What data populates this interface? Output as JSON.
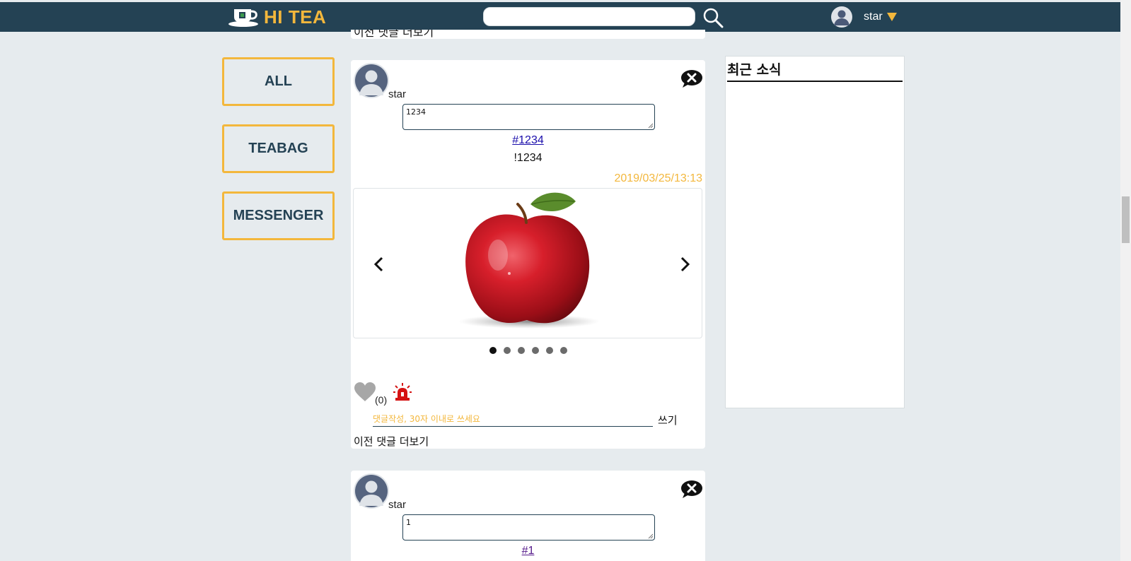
{
  "header": {
    "brand": "HI TEA",
    "search": {
      "placeholder": ""
    },
    "user": {
      "name": "star"
    }
  },
  "colors": {
    "header_bg": "#244254",
    "accent": "#f3b73c",
    "page_bg": "#e6ebee"
  },
  "icons": {
    "logo": "teacup-logo-icon",
    "search": "magnifier-icon",
    "user_avatar": "user-avatar-icon",
    "menu_caret": "caret-down-icon",
    "delete": "close-bubble-icon",
    "like": "heart-icon",
    "report": "siren-icon",
    "prev": "chevron-left-icon",
    "next": "chevron-right-icon"
  },
  "categories": [
    {
      "label": "ALL"
    },
    {
      "label": "TEABAG"
    },
    {
      "label": "MESSENGER"
    }
  ],
  "feed": {
    "prev_tail_text": "이전 댓글 더보기",
    "posts": [
      {
        "author": "star",
        "text_value": "1234",
        "tag": "#1234",
        "body": "!1234",
        "date": "2019/03/25/13:13",
        "carousel": {
          "slide_count": 6,
          "active_slide": 1
        },
        "like_count": "(0)",
        "comment_placeholder": "댓글작성, 30자 이내로 쓰세요",
        "write_label": "쓰기",
        "more_comments": "이전 댓글 더보기"
      },
      {
        "author": "star",
        "text_value": "1",
        "tag": "#1"
      }
    ]
  },
  "news": {
    "title": "최근 소식"
  }
}
